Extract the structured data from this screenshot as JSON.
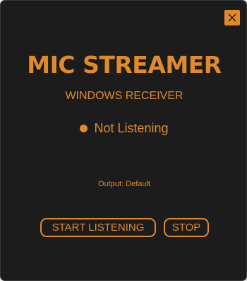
{
  "window": {
    "title": "MIC STREAMER",
    "subtitle": "WINDOWS RECEIVER",
    "close_icon": "close-icon"
  },
  "status": {
    "text": "Not Listening",
    "indicator_color": "#e08a2c"
  },
  "output": {
    "label": "Output: Default"
  },
  "buttons": {
    "start_label": "START LISTENING",
    "stop_label": "STOP"
  },
  "colors": {
    "accent": "#e08a2c",
    "background": "#1c1c1c"
  }
}
